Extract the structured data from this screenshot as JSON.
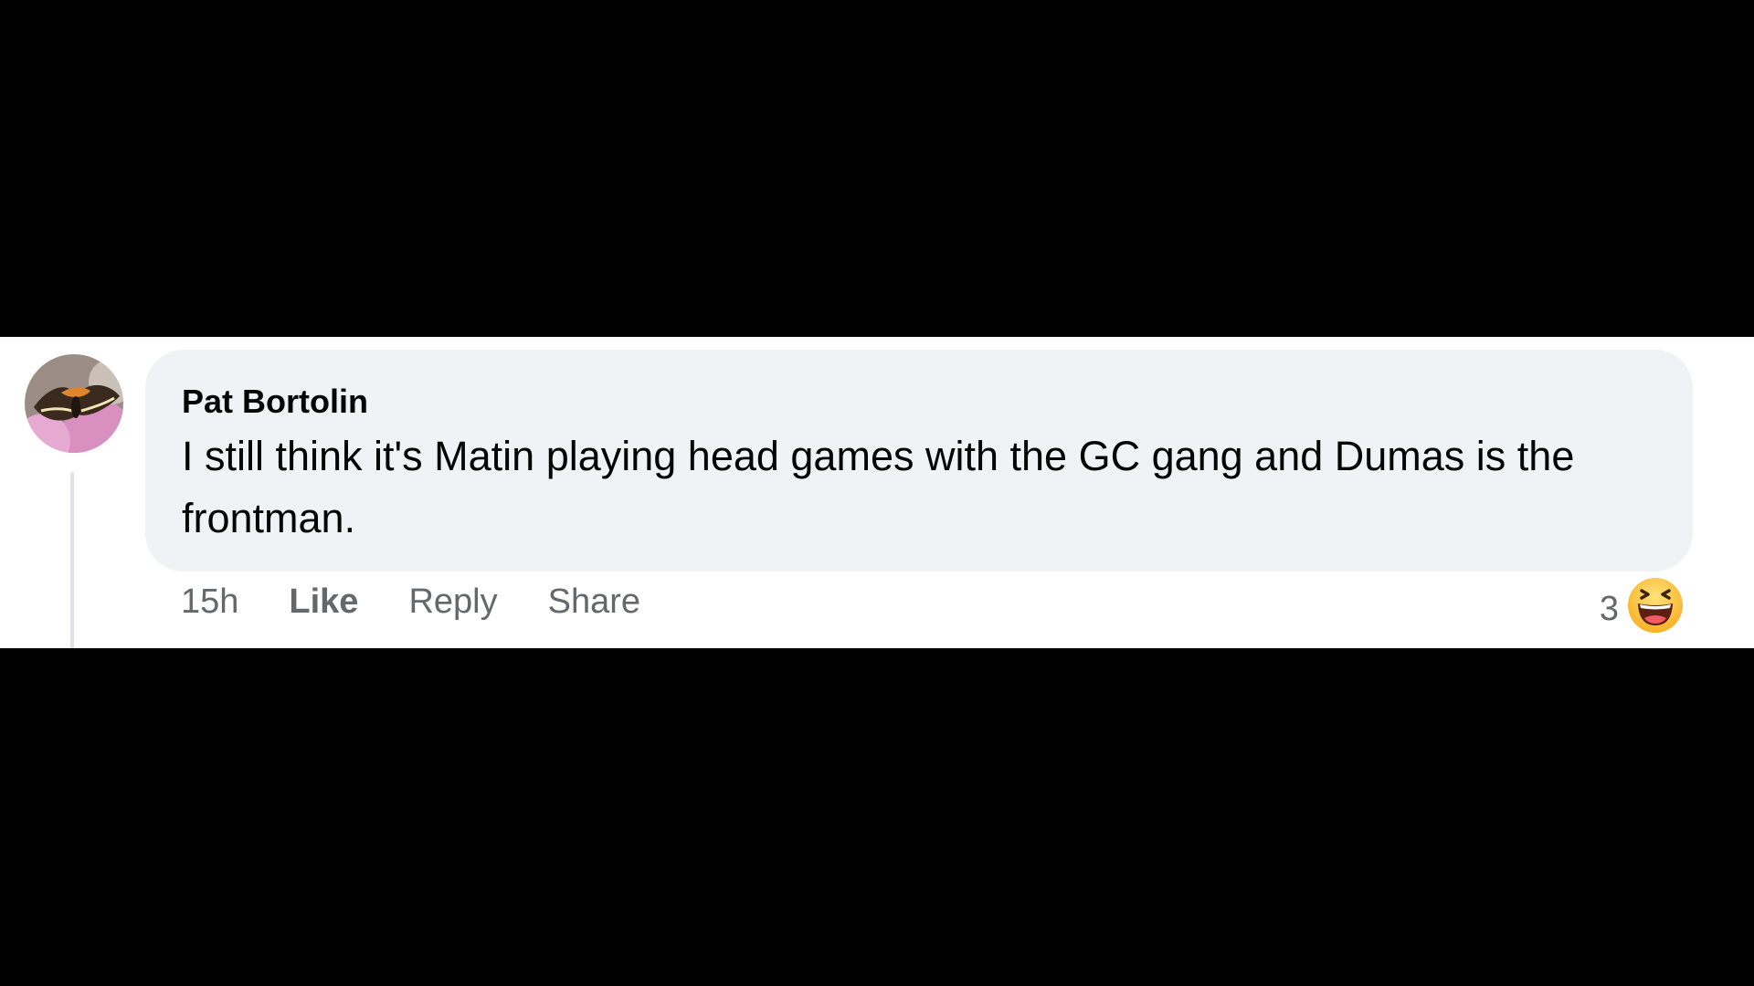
{
  "comment": {
    "author": "Pat Bortolin",
    "text": "I still think it's Matin playing head games with the GC gang and Dumas is the frontman.",
    "avatar_icon": "butterfly-avatar"
  },
  "actions": {
    "time": "15h",
    "like": "Like",
    "reply": "Reply",
    "share": "Share"
  },
  "reactions": {
    "count": "3",
    "icon": "haha-emoji-icon"
  },
  "colors": {
    "bubble": "#f0f2f5",
    "text": "#050505",
    "secondary_text": "#65676b",
    "background": "#000000"
  }
}
